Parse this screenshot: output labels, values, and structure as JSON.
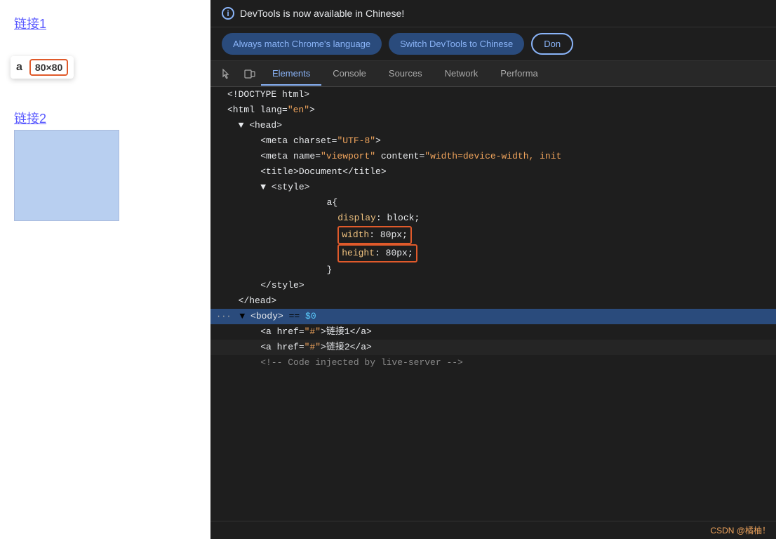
{
  "left": {
    "link1_text": "链接1",
    "tooltip": {
      "label": "a",
      "size": "80×80"
    },
    "link2_text": "链接2"
  },
  "devtools": {
    "info_message": "DevTools is now available in Chinese!",
    "buttons": [
      {
        "label": "Always match Chrome's language",
        "type": "filled"
      },
      {
        "label": "Switch DevTools to Chinese",
        "type": "filled"
      },
      {
        "label": "Don",
        "type": "outline"
      }
    ],
    "tabs": [
      {
        "label": "Elements",
        "active": true
      },
      {
        "label": "Console",
        "active": false
      },
      {
        "label": "Sources",
        "active": false
      },
      {
        "label": "Network",
        "active": false
      },
      {
        "label": "Performa",
        "active": false
      }
    ],
    "code_lines": [
      {
        "indent": 1,
        "content": "<!DOCTYPE html>",
        "type": "tag"
      },
      {
        "indent": 1,
        "content": "<html lang=\"en\">",
        "type": "tag"
      },
      {
        "indent": 2,
        "content": "▼ <head>",
        "type": "tag"
      },
      {
        "indent": 3,
        "content": "<meta charset=\"UTF-8\">",
        "type": "tag"
      },
      {
        "indent": 3,
        "content": "<meta name=\"viewport\" content=\"width=device-width, init",
        "type": "tag"
      },
      {
        "indent": 3,
        "content": "<title>Document</title>",
        "type": "tag"
      },
      {
        "indent": 3,
        "content": "▼ <style>",
        "type": "tag"
      },
      {
        "indent": 5,
        "content": "a{",
        "type": "css"
      },
      {
        "indent": 5,
        "content": "display: block;",
        "type": "css-prop"
      },
      {
        "indent": 5,
        "content": "width: 80px;",
        "type": "css-prop-outlined"
      },
      {
        "indent": 5,
        "content": "height: 80px;",
        "type": "css-prop-outlined"
      },
      {
        "indent": 5,
        "content": "}",
        "type": "css"
      },
      {
        "indent": 3,
        "content": "</style>",
        "type": "tag"
      },
      {
        "indent": 2,
        "content": "</head>",
        "type": "tag"
      },
      {
        "indent": 1,
        "content": "▼ <body> == $0",
        "type": "highlighted"
      },
      {
        "indent": 2,
        "content": "<a href=\"#\">链接1</a>",
        "type": "tag"
      },
      {
        "indent": 2,
        "content": "<a href=\"#\">链接2</a>",
        "type": "tag-darker"
      },
      {
        "indent": 2,
        "content": "<!-- Code injected by live-server -->",
        "type": "comment"
      }
    ],
    "status": "CSDN @橘柚！"
  }
}
